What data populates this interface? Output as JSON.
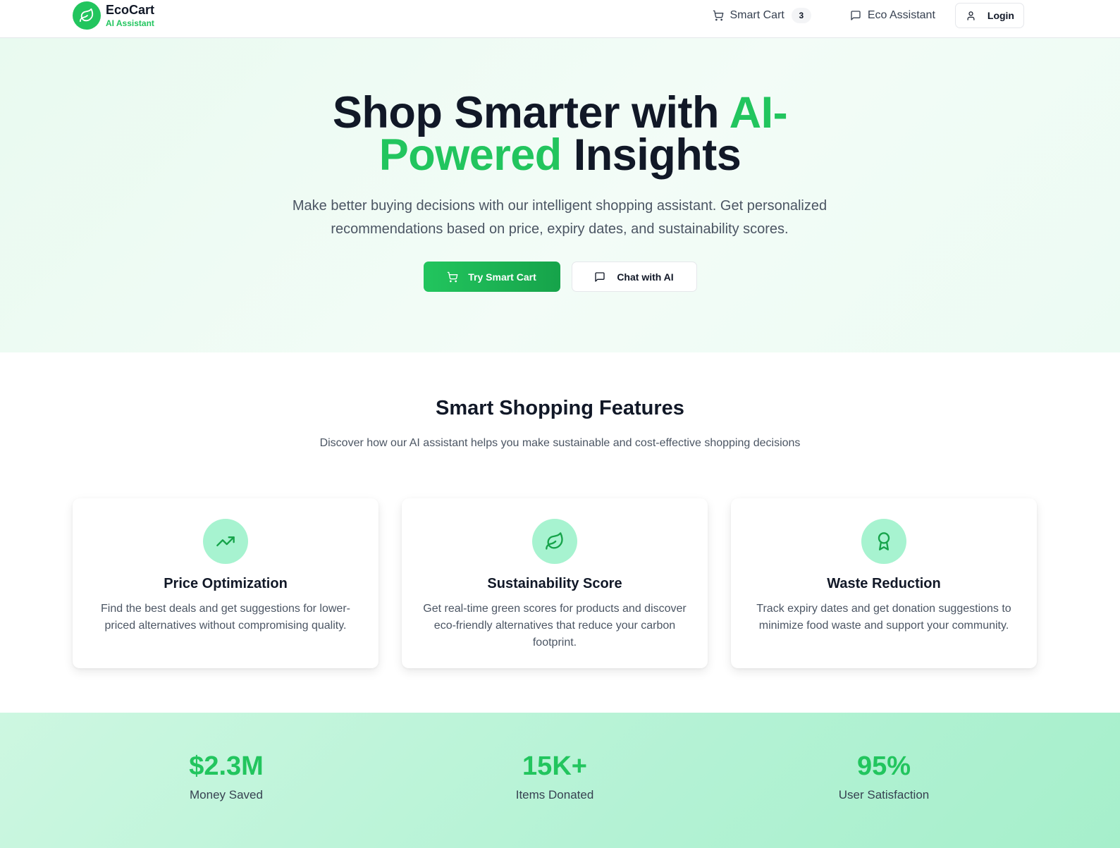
{
  "colors": {
    "accent": "#22c55e",
    "accent_dark": "#16a34a",
    "text": "#111827",
    "muted": "#4b5563"
  },
  "brand": {
    "name": "EcoCart",
    "subtitle": "AI Assistant",
    "icon": "leaf-icon"
  },
  "nav": {
    "smart_cart_label": "Smart Cart",
    "smart_cart_count": "3",
    "eco_assistant_label": "Eco Assistant",
    "login_label": "Login"
  },
  "hero": {
    "title_part1": "Shop Smarter with ",
    "title_accent_a": "AI-",
    "title_accent_b": "Powered",
    "title_part2": " Insights",
    "subtitle": "Make better buying decisions with our intelligent shopping assistant. Get personalized recommendations based on price, expiry dates, and sustainability scores.",
    "primary_button": "Try Smart Cart",
    "secondary_button": "Chat with AI"
  },
  "features": {
    "title": "Smart Shopping Features",
    "subtitle": "Discover how our AI assistant helps you make sustainable and cost-effective shopping decisions",
    "cards": [
      {
        "icon": "trending-up-icon",
        "title": "Price Optimization",
        "text": "Find the best deals and get suggestions for lower-priced alternatives without compromising quality."
      },
      {
        "icon": "leaf-icon",
        "title": "Sustainability Score",
        "text": "Get real-time green scores for products and discover eco-friendly alternatives that reduce your carbon footprint."
      },
      {
        "icon": "award-icon",
        "title": "Waste Reduction",
        "text": "Track expiry dates and get donation suggestions to minimize food waste and support your community."
      }
    ]
  },
  "stats": [
    {
      "value": "$2.3M",
      "label": "Money Saved"
    },
    {
      "value": "15K+",
      "label": "Items Donated"
    },
    {
      "value": "95%",
      "label": "User Satisfaction"
    }
  ]
}
